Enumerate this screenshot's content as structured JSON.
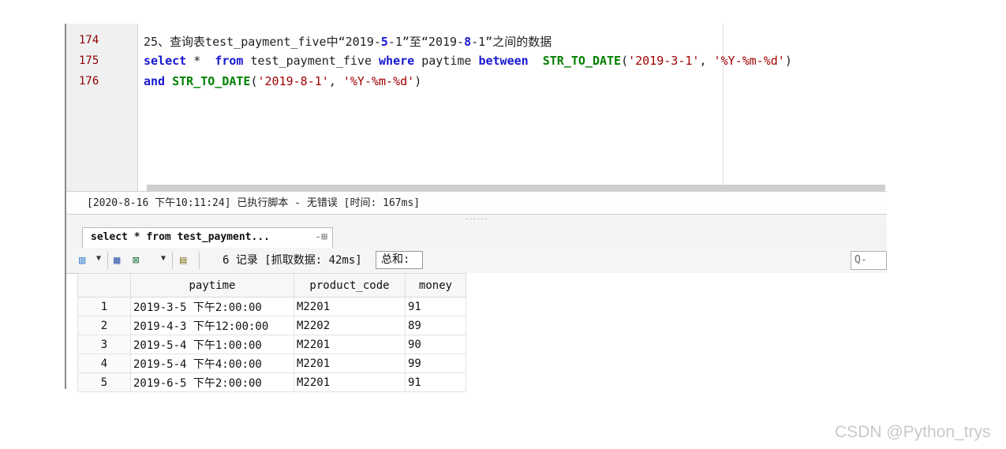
{
  "editor": {
    "lines": [
      {
        "num": "174",
        "segments": [
          {
            "t": "25、查询表test_payment_five中“2019-",
            "c": ""
          },
          {
            "t": "5",
            "c": "kw"
          },
          {
            "t": "-1”至“2019-",
            "c": ""
          },
          {
            "t": "8",
            "c": "kw"
          },
          {
            "t": "-1”之间的数据",
            "c": ""
          }
        ]
      },
      {
        "num": "175",
        "segments": [
          {
            "t": "select",
            "c": "kw"
          },
          {
            "t": " *  ",
            "c": ""
          },
          {
            "t": "from",
            "c": "kw"
          },
          {
            "t": " test_payment_five ",
            "c": ""
          },
          {
            "t": "where",
            "c": "kw"
          },
          {
            "t": " paytime ",
            "c": ""
          },
          {
            "t": "between",
            "c": "kw"
          },
          {
            "t": "  ",
            "c": ""
          },
          {
            "t": "STR_TO_DATE",
            "c": "fn"
          },
          {
            "t": "(",
            "c": ""
          },
          {
            "t": "'2019-3-1'",
            "c": "str"
          },
          {
            "t": ", ",
            "c": ""
          },
          {
            "t": "'%Y-%m-%d'",
            "c": "str"
          },
          {
            "t": ")",
            "c": ""
          }
        ]
      },
      {
        "num": "176",
        "segments": [
          {
            "t": "and",
            "c": "kw"
          },
          {
            "t": " ",
            "c": ""
          },
          {
            "t": "STR_TO_DATE",
            "c": "fn"
          },
          {
            "t": "(",
            "c": ""
          },
          {
            "t": "'2019-8-1'",
            "c": "str"
          },
          {
            "t": ", ",
            "c": ""
          },
          {
            "t": "'%Y-%m-%d'",
            "c": "str"
          },
          {
            "t": ")",
            "c": ""
          }
        ]
      }
    ]
  },
  "status": {
    "text": "[2020-8-16 下午10:11:24] 已执行脚本 - 无错误  [时间: 167ms]"
  },
  "result_tab": {
    "label": "select *  from test_payment..."
  },
  "toolbar": {
    "records": "6 记录 [抓取数据: 42ms]",
    "sum_label": "总和:",
    "search_placeholder": "Q-"
  },
  "grid": {
    "headers": [
      "paytime",
      "product_code",
      "money"
    ],
    "rows": [
      {
        "n": "1",
        "paytime": "2019-3-5 下午2:00:00",
        "product_code": "M2201",
        "money": "91"
      },
      {
        "n": "2",
        "paytime": "2019-4-3 下午12:00:00",
        "product_code": "M2202",
        "money": "89"
      },
      {
        "n": "3",
        "paytime": "2019-5-4 下午1:00:00",
        "product_code": "M2201",
        "money": "90"
      },
      {
        "n": "4",
        "paytime": "2019-5-4 下午4:00:00",
        "product_code": "M2201",
        "money": "99"
      },
      {
        "n": "5",
        "paytime": "2019-6-5 下午2:00:00",
        "product_code": "M2201",
        "money": "91"
      }
    ]
  },
  "watermark": "CSDN @Python_trys",
  "colors": {
    "keyword": "#1818d0",
    "function": "#008000",
    "string": "#a00000",
    "line_number": "#8b0000"
  }
}
